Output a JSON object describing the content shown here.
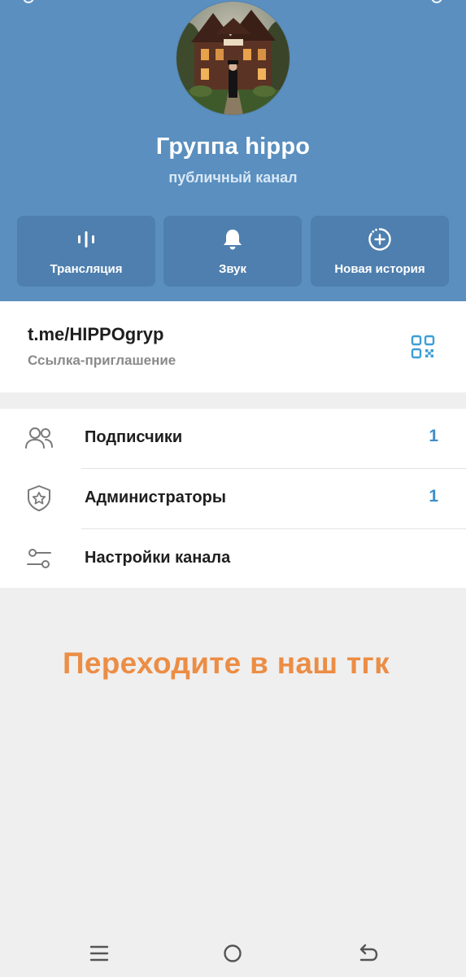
{
  "header": {
    "title": "Группа hippo",
    "subtitle": "публичный канал",
    "avatar_icon": "channel-avatar-house-icon",
    "bg_color": "#5a8fbf"
  },
  "actions": [
    {
      "label": "Трансляция",
      "icon": "live-stream-icon"
    },
    {
      "label": "Звук",
      "icon": "bell-icon"
    },
    {
      "label": "Новая история",
      "icon": "add-story-icon"
    }
  ],
  "invite": {
    "url": "t.me/HIPPOgryp",
    "label": "Ссылка-приглашение",
    "icon": "qr-code-icon"
  },
  "menu": [
    {
      "label": "Подписчики",
      "count": "1",
      "icon": "subscribers-icon"
    },
    {
      "label": "Администраторы",
      "count": "1",
      "icon": "admin-shield-icon"
    },
    {
      "label": "Настройки канала",
      "count": "",
      "icon": "settings-sliders-icon"
    }
  ],
  "promo": {
    "text": "Переходите в наш тгк",
    "color": "#ec8d45"
  },
  "navbar": {
    "icons": [
      "recent-apps-icon",
      "home-icon",
      "back-icon"
    ]
  },
  "colors": {
    "accent": "#3d8ec9",
    "action_button": "#4e7fae"
  }
}
